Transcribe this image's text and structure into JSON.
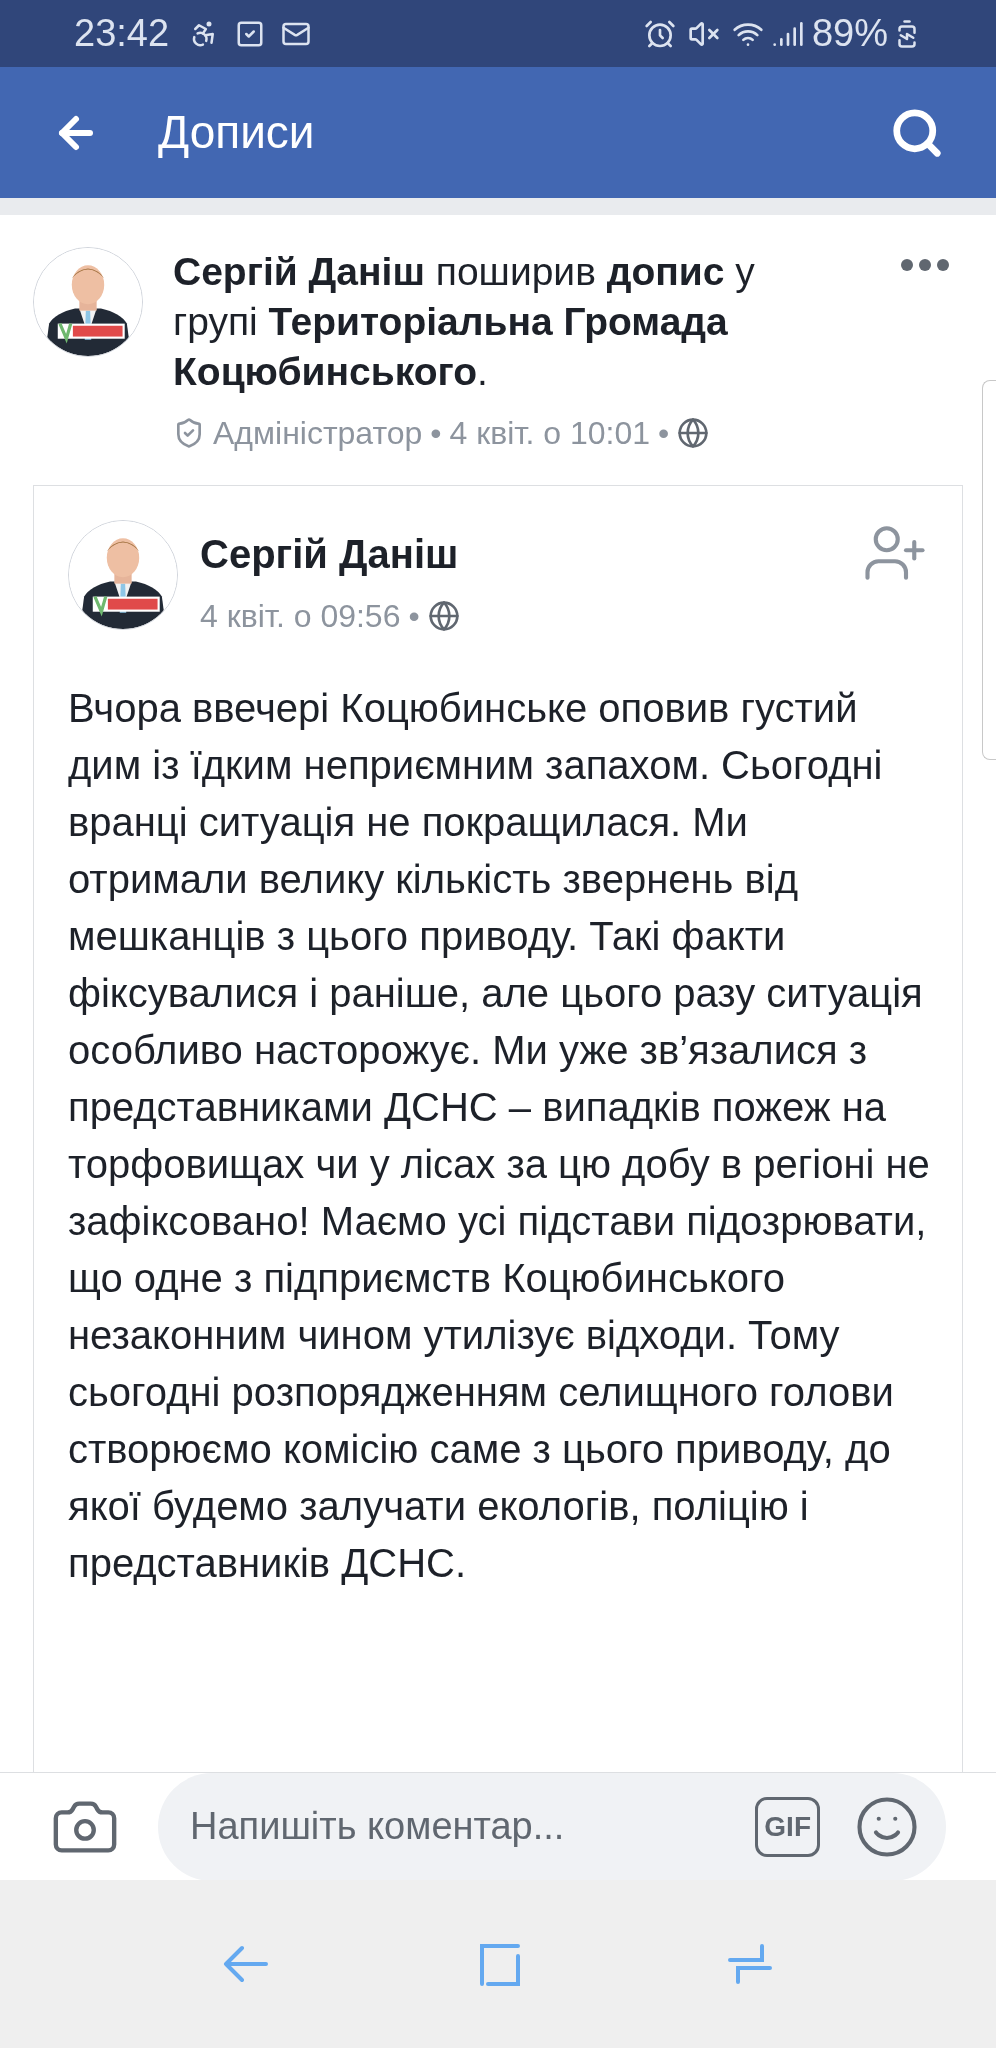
{
  "status_bar": {
    "time": "23:42",
    "battery": "89%"
  },
  "header": {
    "title": "Дописи"
  },
  "share": {
    "text": "**Сергій Даніш** поширив **допис** у групі **Територіальна Громада Коцюбинського**.",
    "meta": [
      "Адміністратор",
      "•",
      "4 квіт. о 10:01",
      "•"
    ]
  },
  "post": {
    "author": "Сергій Даніш",
    "meta": [
      "4 квіт. о 09:56",
      "•"
    ],
    "body": "Вчора ввечері Коцюбинське оповив густий дим із їдким неприємним запахом. Сьогодні вранці ситуація не покращилася. Ми отримали велику кількість звернень від мешканців з цього приводу. Такі факти фіксувалися і раніше, але цього разу ситуація особливо насторожує. Ми уже зв’язалися з представниками ДСНС – випадків пожеж на торфовищах чи у лісах за цю добу в регіоні не зафіксовано! Маємо усі підстави підозрювати, що одне з підприємств Коцюбинського незаконним чином утилізує відходи. Тому сьогодні розпорядженням селищного голови створюємо комісію саме з цього приводу, до якої будемо залучати екологів, поліцію і представників ДСНС."
  },
  "comment_bar": {
    "placeholder": "Напишіть коментар...",
    "gif_label": "GIF"
  }
}
